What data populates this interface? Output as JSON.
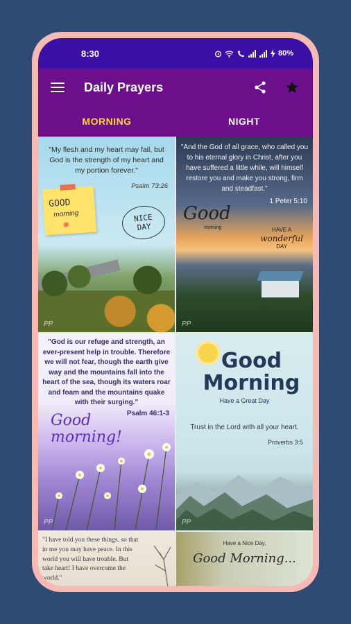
{
  "status_bar": {
    "time": "8:30",
    "battery": "80%"
  },
  "app_bar": {
    "title": "Daily Prayers"
  },
  "tabs": [
    {
      "label": "MORNING",
      "active": true
    },
    {
      "label": "NIGHT",
      "active": false
    }
  ],
  "colors": {
    "background": "#2f4a73",
    "phone_frame": "#f6b9b4",
    "status_bar": "#3c10a6",
    "app_bar": "#6d0f8a",
    "active_tab": "#ffd92a"
  },
  "cards": [
    {
      "quote": "\"My flesh and my heart may fail, but God is the strength of my heart and my portion forever.\"",
      "ref": "Psalm 73:26",
      "sticky_greet": "GOOD",
      "sticky_sub": "morning",
      "badge_line1": "NICE",
      "badge_line2": "DAY",
      "watermark": "PP"
    },
    {
      "quote": "\"And the God of all grace, who called you to his eternal glory in Christ, after you have suffered a little while, will himself restore you and make you strong, firm and steadfast.\"",
      "ref": "1 Peter 5:10",
      "greet": "Good",
      "greet_sub": "morning",
      "wonder_top": "HAVE A",
      "wonder_mid": "wonderful",
      "wonder_bottom": "DAY",
      "watermark": "PP"
    },
    {
      "quote": "\"God is our refuge and strength, an ever-present help in trouble. Therefore we will not fear, though the earth give way and the mountains fall into the heart of the sea, though its waters roar and foam and the mountains quake with their surging.\"",
      "ref": "Psalm 46:1-3",
      "greet_line1": "Good",
      "greet_line2": "morning!",
      "watermark": "PP"
    },
    {
      "greet_line1": "Good",
      "greet_line2": "Morning",
      "sub": "Have a Great Day",
      "quote": "Trust in the Lord with all your heart.",
      "ref": "Proverbs 3:5",
      "watermark": "PP"
    },
    {
      "quote": "\"I have told you these things, so that in me you may have peace. In this world you will have trouble. But take heart! I have overcome the world.\""
    },
    {
      "small": "Have a Nice Day,",
      "greet": "Good Morning..."
    }
  ]
}
